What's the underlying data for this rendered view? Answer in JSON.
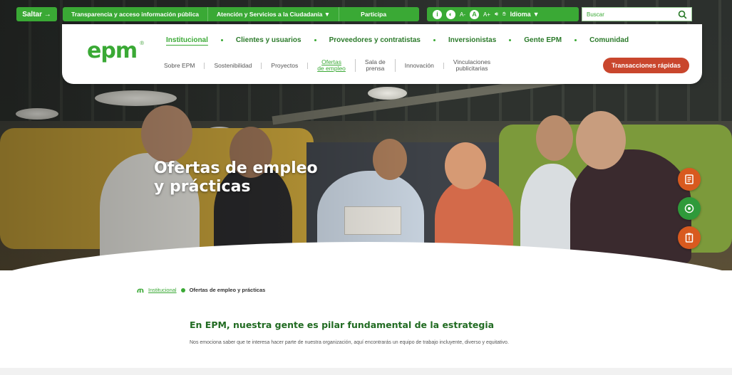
{
  "top": {
    "skip_label": "Saltar →",
    "util_items": [
      "Transparencia y acceso información pública",
      "Atención y Servicios a la Ciudadanía ▼",
      "Participa"
    ],
    "access": {
      "font_small": "A-",
      "font_normal": "A",
      "font_large": "A+",
      "language": "Idioma"
    },
    "search_placeholder": "Buscar"
  },
  "header": {
    "logo": "epm",
    "main_nav": [
      "Institucional",
      "Clientes y usuarios",
      "Proveedores y contratistas",
      "Inversionistas",
      "Gente EPM",
      "Comunidad"
    ],
    "sub_nav": [
      "Sobre EPM",
      "Sostenibilidad",
      "Proyectos",
      "Ofertas\nde empleo",
      "Sala de\nprensa",
      "Innovación",
      "Vinculaciones\npublicitarias"
    ],
    "quick_button": "Transacciones rápidas"
  },
  "hero": {
    "title_line1": "Ofertas de empleo",
    "title_line2": "y prácticas"
  },
  "breadcrumb": {
    "root": "Institucional",
    "current": "Ofertas de empleo y prácticas"
  },
  "content": {
    "title": "En EPM, nuestra gente es pilar fundamental de la estrategia",
    "text": "Nos emociona saber que te interesa hacer parte de nuestra organización, aquí encontrarás un equipo de trabajo incluyente, diverso y equitativo."
  },
  "colors": {
    "brand_green": "#3aa935",
    "accent_orange": "#c9462d"
  }
}
